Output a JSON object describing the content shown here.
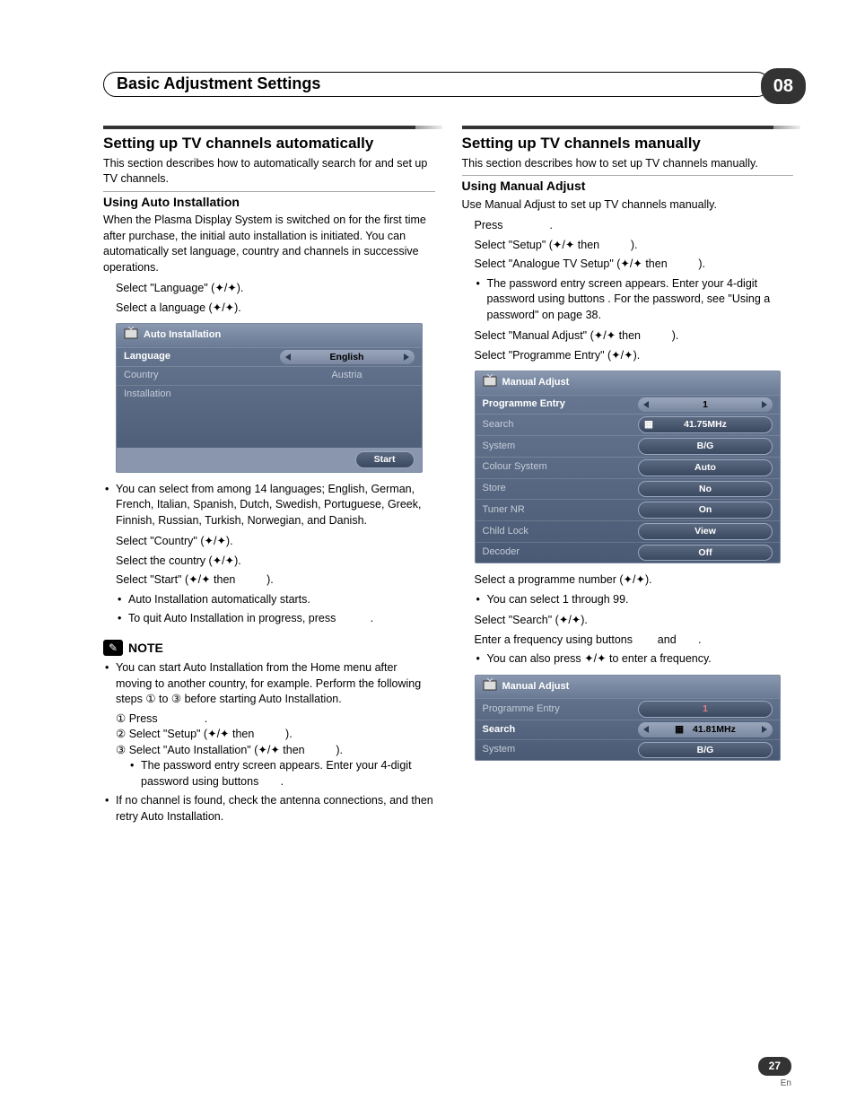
{
  "chapter": {
    "title": "Basic Adjustment Settings",
    "number": "08"
  },
  "page": {
    "num": "27",
    "lang": "En"
  },
  "left": {
    "h1": "Setting up TV channels automatically",
    "intro": "This section describes how to automatically search for and set up TV channels.",
    "h2": "Using Auto Installation",
    "body1": "When the Plasma Display System is switched on for the first time after purchase, the initial auto installation is initiated. You can automatically set language, country and channels in successive operations.",
    "s1": "Select \"Language\" (",
    "s2": "Select a language (",
    "osd": {
      "title": "Auto Installation",
      "rows": [
        {
          "label": "Language",
          "value": "English",
          "pill": true
        },
        {
          "label": "Country",
          "value": "Austria",
          "pill": false
        },
        {
          "label": "Installation",
          "value": "",
          "pill": false
        }
      ],
      "start": "Start"
    },
    "langnote": "You can select from among 14 languages; English, German, French, Italian, Spanish, Dutch, Swedish, Portuguese, Greek, Finnish, Russian, Turkish, Norwegian, and Danish.",
    "s3": "Select \"Country\" (",
    "s4": "Select the country (",
    "s5a": "Select \"Start\" (",
    "s5b": " then ",
    "b1": "Auto Installation automatically starts.",
    "b2": "To quit Auto Installation in progress, press ",
    "note_label": "NOTE",
    "n1": "You can start Auto Installation from the Home menu after moving to another country, for example. Perform the following steps ① to ③ before starting Auto Installation.",
    "n1a": "Press ",
    "n1b_a": "Select \"Setup\" (",
    "n1b_b": " then ",
    "n1c_a": "Select \"Auto Installation\" (",
    "n1c_b": " then ",
    "n1d": "The password entry screen appears. Enter your 4-digit password using buttons ",
    "n2": "If no channel is found, check the antenna connections, and then retry Auto Installation."
  },
  "right": {
    "h1": "Setting up TV channels manually",
    "intro": "This section describes how to set up TV channels manually.",
    "h2": "Using Manual Adjust",
    "body1": "Use Manual Adjust to set up TV channels manually.",
    "s1": "Press ",
    "s2a": "Select \"Setup\" (",
    "s2b": " then ",
    "s3a": "Select \"Analogue TV Setup\" (",
    "s3b": " then ",
    "pw": "The password entry screen appears. Enter your 4-digit password using buttons           . For the password, see \"Using a password\" on page 38.",
    "s4a": "Select \"Manual Adjust\" (",
    "s4b": " then ",
    "s5": "Select \"Programme Entry\" (",
    "osd1": {
      "title": "Manual Adjust",
      "rows": [
        {
          "label": "Programme Entry",
          "value": "1",
          "arrows": true
        },
        {
          "label": "Search",
          "value": "41.75MHz",
          "icon": true
        },
        {
          "label": "System",
          "value": "B/G"
        },
        {
          "label": "Colour System",
          "value": "Auto"
        },
        {
          "label": "Store",
          "value": "No"
        },
        {
          "label": "Tuner NR",
          "value": "On"
        },
        {
          "label": "Child Lock",
          "value": "View"
        },
        {
          "label": "Decoder",
          "value": "Off"
        }
      ]
    },
    "s6": "Select a programme number (",
    "b1": "You can select 1 through 99.",
    "s7": "Select \"Search\" (",
    "s8a": "Enter a frequency using buttons ",
    "s8b": " and ",
    "b2a": "You can also press ",
    "b2b": " to enter a frequency.",
    "osd2": {
      "title": "Manual Adjust",
      "rows": [
        {
          "label": "Programme Entry",
          "value": "1"
        },
        {
          "label": "Search",
          "value": "41.81MHz",
          "arrows": true,
          "icon": true
        },
        {
          "label": "System",
          "value": "B/G"
        }
      ]
    }
  }
}
